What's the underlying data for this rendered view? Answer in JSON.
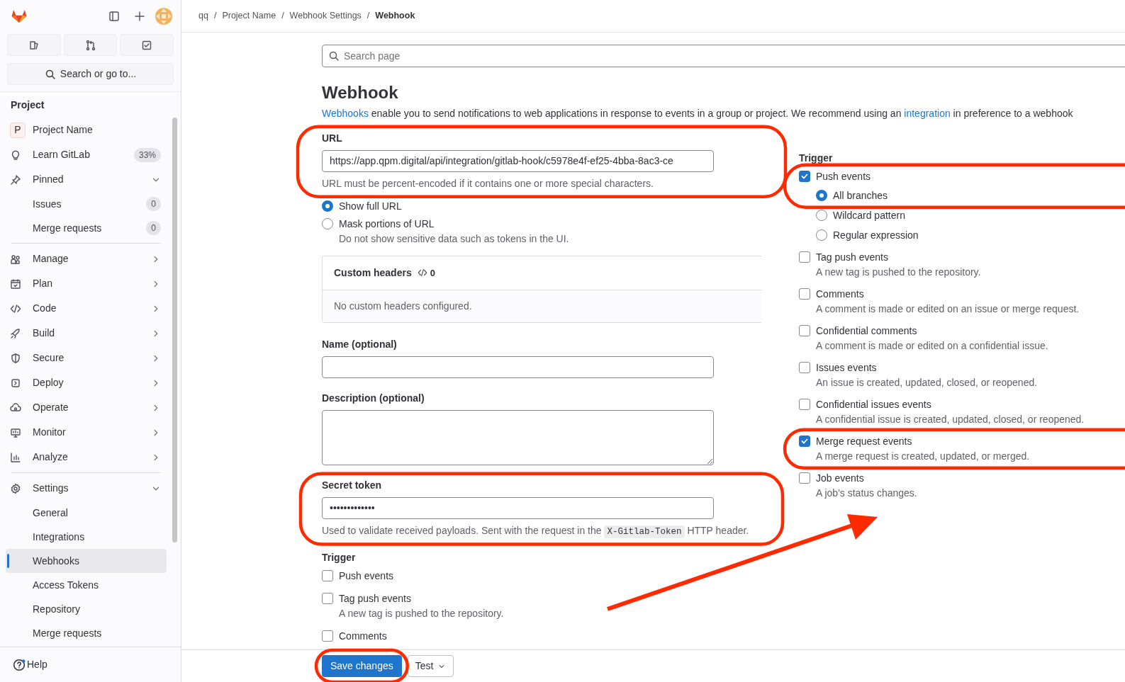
{
  "sidebar": {
    "search": "Search or go to...",
    "section_title": "Project",
    "sections": [
      [
        {
          "kind": "project",
          "avatar": "P",
          "label": "Project Name",
          "selected": false
        },
        {
          "kind": "link",
          "label": "Learn GitLab",
          "badge": "33%",
          "selected": false
        },
        {
          "kind": "group",
          "label": "Pinned",
          "expanded": true,
          "children": [
            {
              "label": "Issues",
              "badge": "0",
              "selected": false
            },
            {
              "label": "Merge requests",
              "badge": "0",
              "selected": false
            }
          ]
        }
      ],
      [
        {
          "kind": "group",
          "label": "Manage",
          "expanded": false
        },
        {
          "kind": "group",
          "label": "Plan",
          "expanded": false
        },
        {
          "kind": "group",
          "label": "Code",
          "expanded": false
        },
        {
          "kind": "group",
          "label": "Build",
          "expanded": false
        },
        {
          "kind": "group",
          "label": "Secure",
          "expanded": false
        },
        {
          "kind": "group",
          "label": "Deploy",
          "expanded": false
        },
        {
          "kind": "group",
          "label": "Operate",
          "expanded": false
        },
        {
          "kind": "group",
          "label": "Monitor",
          "expanded": false
        },
        {
          "kind": "group",
          "label": "Analyze",
          "expanded": false
        }
      ],
      [
        {
          "kind": "group",
          "label": "Settings",
          "expanded": true,
          "children": [
            {
              "label": "General",
              "selected": false
            },
            {
              "label": "Integrations",
              "selected": false
            },
            {
              "label": "Webhooks",
              "selected": true
            },
            {
              "label": "Access Tokens",
              "selected": false
            },
            {
              "label": "Repository",
              "selected": false
            },
            {
              "label": "Merge requests",
              "selected": false
            }
          ]
        }
      ]
    ],
    "help": "Help"
  },
  "breadcrumbs": [
    {
      "label": "qq",
      "current": false
    },
    {
      "separator": "/",
      "label": "Project Name",
      "current": false
    },
    {
      "separator": "/",
      "label": "Webhook Settings",
      "current": false
    },
    {
      "separator": "/",
      "label": "Webhook",
      "current": true
    }
  ],
  "search_page": {
    "placeholder": "Search page"
  },
  "title": "Webhook",
  "description": [
    {
      "kind": "link",
      "text": "Webhooks"
    },
    {
      "kind": "text",
      "text": " enable you to send notifications to web applications in response to events in a group or project. We recommend using an "
    },
    {
      "kind": "link",
      "text": "integration"
    },
    {
      "kind": "text",
      "text": " in preference to a webhook"
    }
  ],
  "url": {
    "label": "URL",
    "value": "https://app.qpm.digital/api/integration/gitlab-hook/c5978e4f-ef25-4bba-8ac3-ce",
    "help": "URL must be percent-encoded if it contains one or more special characters."
  },
  "url_display": [
    {
      "label": "Show full URL",
      "selected": true
    },
    {
      "label": "Mask portions of URL",
      "selected": false,
      "help": "Do not show sensitive data such as tokens in the UI."
    }
  ],
  "custom_headers": {
    "title": "Custom headers",
    "count": "0",
    "empty": "No custom headers configured."
  },
  "name": {
    "label": "Name (optional)"
  },
  "description_field": {
    "label": "Description (optional)"
  },
  "secret_token": {
    "label": "Secret token",
    "value": "•••••••••••••",
    "help": [
      {
        "kind": "text",
        "text": "Used to validate received payloads. Sent with the request in the "
      },
      {
        "kind": "code",
        "text": "X-Gitlab-Token"
      },
      {
        "kind": "text",
        "text": " HTTP header."
      }
    ]
  },
  "trigger": {
    "title": "Trigger",
    "items": [
      {
        "label": "Push events",
        "checked": false
      },
      {
        "label": "Tag push events",
        "checked": false,
        "help": "A new tag is pushed to the repository."
      },
      {
        "label": "Comments",
        "checked": false
      }
    ]
  },
  "trigger_panel": {
    "title": "Trigger",
    "items": [
      {
        "label": "Push events",
        "checked": true,
        "options": [
          {
            "label": "All branches",
            "selected": true
          },
          {
            "label": "Wildcard pattern",
            "selected": false
          },
          {
            "label": "Regular expression",
            "selected": false
          }
        ]
      },
      {
        "label": "Tag push events",
        "checked": false,
        "help": "A new tag is pushed to the repository."
      },
      {
        "label": "Comments",
        "checked": false,
        "help": "A comment is made or edited on an issue or merge request."
      },
      {
        "label": "Confidential comments",
        "checked": false,
        "help": "A comment is made or edited on a confidential issue."
      },
      {
        "label": "Issues events",
        "checked": false,
        "help": "An issue is created, updated, closed, or reopened."
      },
      {
        "label": "Confidential issues events",
        "checked": false,
        "help": "A confidential issue is created, updated, closed, or reopened."
      },
      {
        "label": "Merge request events",
        "checked": true,
        "help": "A merge request is created, updated, or merged."
      },
      {
        "label": "Job events",
        "checked": false,
        "help": "A job's status changes."
      }
    ]
  },
  "footer": {
    "save": "Save changes",
    "test": "Test"
  },
  "annotations": [
    {
      "kind": "outline"
    },
    {
      "kind": "outline"
    },
    {
      "kind": "outline"
    },
    {
      "kind": "outline"
    },
    {
      "kind": "outline"
    },
    {
      "kind": "arrow"
    }
  ]
}
